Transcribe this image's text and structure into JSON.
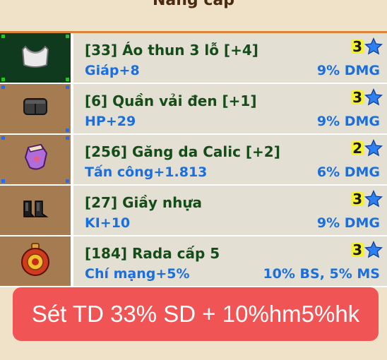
{
  "header": {
    "title": "Nâng cấp"
  },
  "items": [
    {
      "name": "[33] Áo thun 3 lỗ [+4]",
      "stat": "Giáp+8",
      "bonus": "9% DMG",
      "star_count": "3",
      "icon": "tank-top-icon",
      "selected": true
    },
    {
      "name": "[6] Quần vải đen [+1]",
      "stat": "HP+29",
      "bonus": "9% DMG",
      "star_count": "3",
      "icon": "black-pants-icon",
      "selected": false
    },
    {
      "name": "[256] Găng da Calic [+2]",
      "stat": "Tấn công+1.813",
      "bonus": "6% DMG",
      "star_count": "2",
      "icon": "leather-glove-icon",
      "selected": false
    },
    {
      "name": "[27] Giầy nhựa",
      "stat": "KI+10",
      "bonus": "9% DMG",
      "star_count": "3",
      "icon": "plastic-boots-icon",
      "selected": false
    },
    {
      "name": "[184] Rada cấp 5",
      "stat": "Chí mạng+5%",
      "bonus": "10% BS, 5% MS",
      "star_count": "3",
      "icon": "radar-icon",
      "selected": false
    }
  ],
  "banner": {
    "text": "Sét TD 33% SD + 10%hm5%hk"
  },
  "colors": {
    "header_border": "#d9823a",
    "row_bg": "#e3e0d3",
    "slot_bg": "#a57c52",
    "selected_slot_bg": "#0f3a1e",
    "name_color": "#144d17",
    "stat_color": "#1a6fe0",
    "star_count_bg": "#f5f22a",
    "banner_bg": "#f15454"
  }
}
